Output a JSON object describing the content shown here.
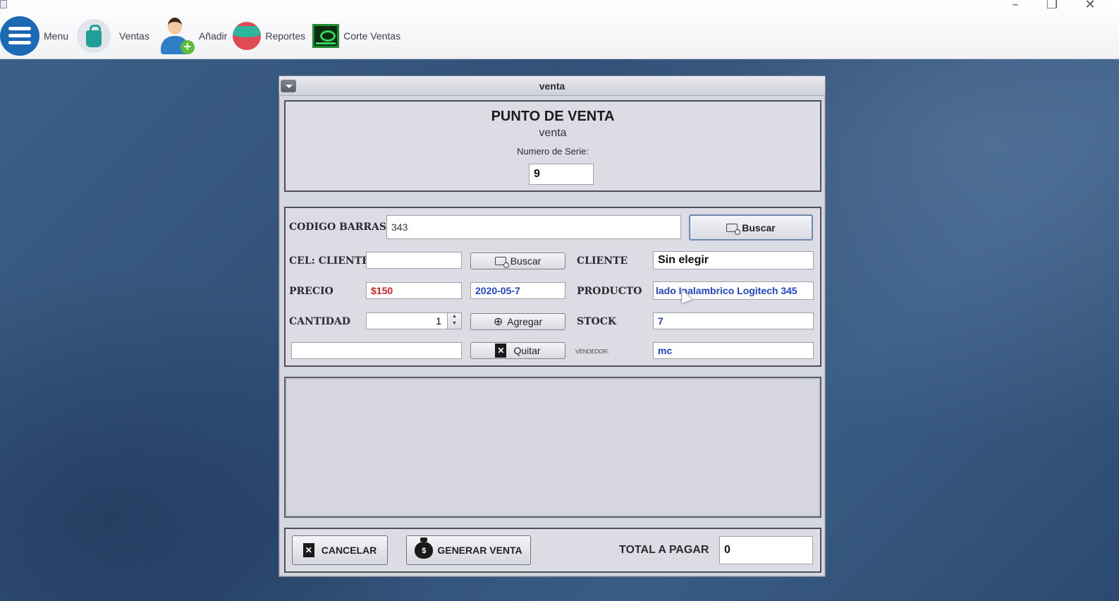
{
  "toolbar": {
    "items": [
      {
        "label": "Menu",
        "icon": "menu-icon"
      },
      {
        "label": "Ventas",
        "icon": "shopping-bag-icon"
      },
      {
        "label": "Añadir",
        "icon": "add-user-icon"
      },
      {
        "label": "Reportes",
        "icon": "report-icon"
      },
      {
        "label": "Corte Ventas",
        "icon": "cash-register-icon"
      }
    ]
  },
  "window_controls": {
    "minimize": "–",
    "restore": "❐",
    "close": "✕"
  },
  "frame": {
    "title": "venta"
  },
  "header": {
    "title": "PUNTO DE VENTA",
    "subtitle": "venta",
    "serie_label": "Numero de Serie:",
    "serie_value": "9"
  },
  "form": {
    "codigo_barras_label": "CODIGO BARRAS",
    "codigo_barras_value": "343",
    "buscar_producto_label": "Buscar",
    "cel_cliente_label": "CEL: CLIENTE",
    "cel_cliente_value": "",
    "buscar_cliente_label": "Buscar",
    "cliente_label": "CLIENTE",
    "cliente_value": "Sin elegir",
    "precio_label": "PRECIO",
    "precio_value": "$150",
    "fecha_value": "2020-05-7",
    "producto_label": "PRODUCTO",
    "producto_value": "lado Inalambrico Logitech 345",
    "cantidad_label": "CANTIDAD",
    "cantidad_value": "1",
    "agregar_label": "Agregar",
    "stock_label": "STOCK",
    "stock_value": "7",
    "extra_value": "",
    "quitar_label": "Quitar",
    "vendedor_label": "VENDEDOR:",
    "vendedor_value": "mc"
  },
  "footer": {
    "cancelar_label": "CANCELAR",
    "generar_label": "GENERAR VENTA",
    "total_label": "TOTAL A PAGAR",
    "total_value": "0"
  },
  "colors": {
    "precio": "#d42020",
    "blue_value": "#2244cc",
    "desktop": "#34557c"
  }
}
